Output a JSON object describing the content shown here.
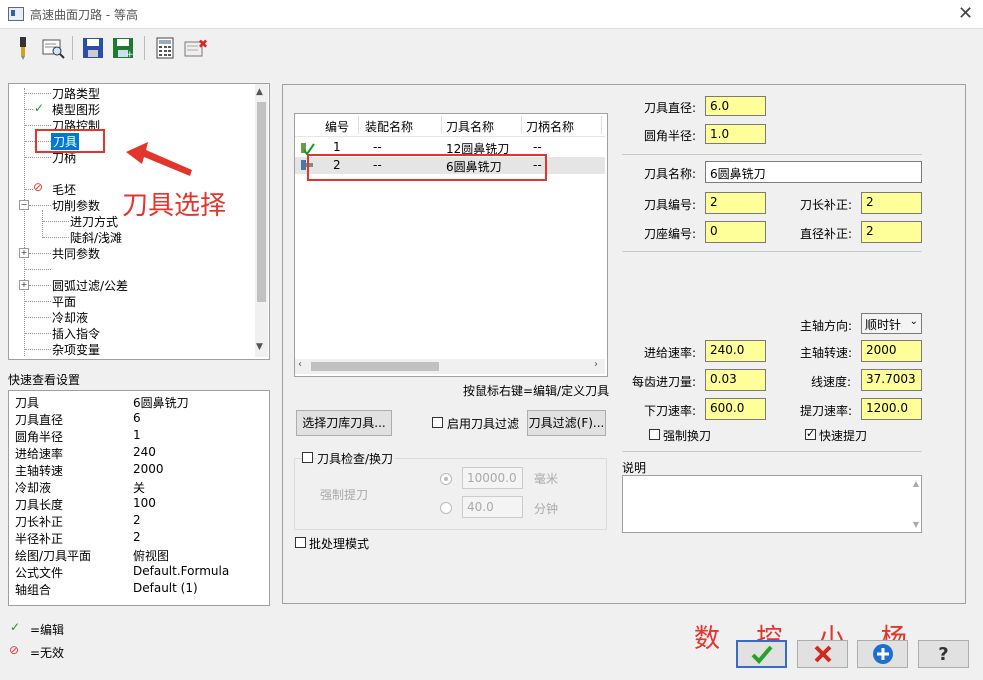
{
  "window": {
    "title": "高速曲面刀路 - 等高",
    "close": "✕"
  },
  "toolbar": {
    "icons": [
      "tool-icon",
      "view-icon",
      "save-icon",
      "save-all-icon",
      "calculator-icon",
      "delete-icon"
    ]
  },
  "tree": {
    "items": [
      {
        "label": "刀路类型"
      },
      {
        "label": "模型图形",
        "mark": "✓"
      },
      {
        "label": "刀路控制"
      },
      {
        "label": "刀具"
      },
      {
        "label": "刀柄"
      },
      {
        "label": "毛坯",
        "mark": "⊘"
      },
      {
        "label": "切削参数"
      },
      {
        "label": "进刀方式"
      },
      {
        "label": "陡斜/浅滩"
      },
      {
        "label": "共同参数"
      },
      {
        "label": "圆弧过滤/公差"
      },
      {
        "label": "平面"
      },
      {
        "label": "冷却液"
      },
      {
        "label": "插入指令"
      },
      {
        "label": "杂项变量"
      }
    ]
  },
  "annotation": {
    "text": "刀具选择",
    "watermark": "数 控 小 杨"
  },
  "quick_view": {
    "title": "快速查看设置",
    "rows": [
      {
        "k": "刀具",
        "v": "6圆鼻铣刀"
      },
      {
        "k": "刀具直径",
        "v": "6"
      },
      {
        "k": "圆角半径",
        "v": "1"
      },
      {
        "k": "进给速率",
        "v": "240"
      },
      {
        "k": "主轴转速",
        "v": "2000"
      },
      {
        "k": "冷却液",
        "v": "关"
      },
      {
        "k": "刀具长度",
        "v": "100"
      },
      {
        "k": "刀长补正",
        "v": "2"
      },
      {
        "k": "半径补正",
        "v": "2"
      },
      {
        "k": "绘图/刀具平面",
        "v": "俯视图"
      },
      {
        "k": "公式文件",
        "v": "Default.Formula"
      },
      {
        "k": "轴组合",
        "v": "Default (1)"
      }
    ]
  },
  "legend": {
    "edit": "=编辑",
    "invalid": "=无效"
  },
  "tool_table": {
    "headers": [
      "编号",
      "装配名称",
      "刀具名称",
      "刀柄名称"
    ],
    "rows": [
      {
        "num": "1",
        "assembly": "--",
        "name": "12圆鼻铣刀",
        "holder": "--"
      },
      {
        "num": "2",
        "assembly": "--",
        "name": "6圆鼻铣刀",
        "holder": "--"
      }
    ],
    "hint": "按鼠标右键=编辑/定义刀具"
  },
  "buttons": {
    "select_library": "选择刀库刀具...",
    "enable_filter": "启用刀具过滤",
    "tool_filter": "刀具过滤(F)..."
  },
  "tool_check": {
    "label": "刀具检查/换刀",
    "force_retract": "强制提刀",
    "dist_value": "10000.0",
    "dist_unit": "毫米",
    "time_value": "40.0",
    "time_unit": "分钟"
  },
  "batch_mode": "批处理模式",
  "params": {
    "tool_diameter_label": "刀具直径:",
    "tool_diameter": "6.0",
    "corner_radius_label": "圆角半径:",
    "corner_radius": "1.0",
    "tool_name_label": "刀具名称:",
    "tool_name": "6圆鼻铣刀",
    "tool_number_label": "刀具编号:",
    "tool_number": "2",
    "length_offset_label": "刀长补正:",
    "length_offset": "2",
    "holder_number_label": "刀座编号:",
    "holder_number": "0",
    "dia_offset_label": "直径补正:",
    "dia_offset": "2",
    "spindle_dir_label": "主轴方向:",
    "spindle_dir": "顺时针",
    "feed_rate_label": "进给速率:",
    "feed_rate": "240.0",
    "spindle_speed_label": "主轴转速:",
    "spindle_speed": "2000",
    "feed_per_tooth_label": "每齿进刀量:",
    "feed_per_tooth": "0.03",
    "surface_speed_label": "线速度:",
    "surface_speed": "37.7003",
    "plunge_rate_label": "下刀速率:",
    "plunge_rate": "600.0",
    "retract_rate_label": "提刀速率:",
    "retract_rate": "1200.0",
    "force_change_label": "强制换刀",
    "rapid_retract_label": "快速提刀",
    "comment_label": "说明"
  },
  "colors": {
    "accent_red": "#e3352c",
    "input_yellow": "#ffff99",
    "select_blue": "#0078d7"
  }
}
